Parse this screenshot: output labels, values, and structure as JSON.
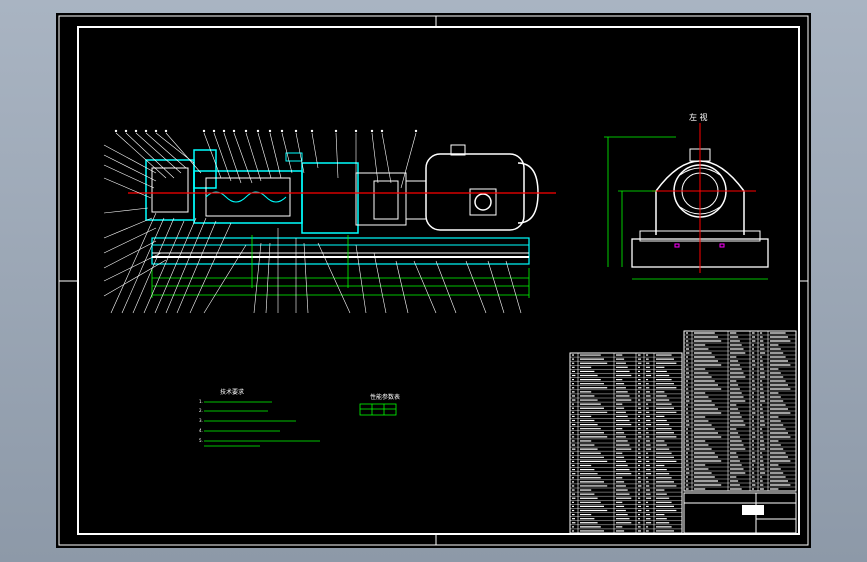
{
  "sheet": {
    "background": "#000000",
    "frame_color": "#ffffff"
  },
  "drawing": {
    "side_view_title": "左 视",
    "tech_requirements_title": "技术要求",
    "performance_table_title": "性能参数表",
    "tech_requirements_lines": [
      "1.",
      "2.",
      "3.",
      "4.",
      "5."
    ]
  },
  "colors": {
    "pump_outline": "#00ffff",
    "motor_outline": "#ffffff",
    "centerline": "#ff0000",
    "dimension_lines": "#00ff00",
    "leader_lines": "#ffffff",
    "note_text": "#00ff00",
    "accent_magenta": "#ff00ff"
  }
}
